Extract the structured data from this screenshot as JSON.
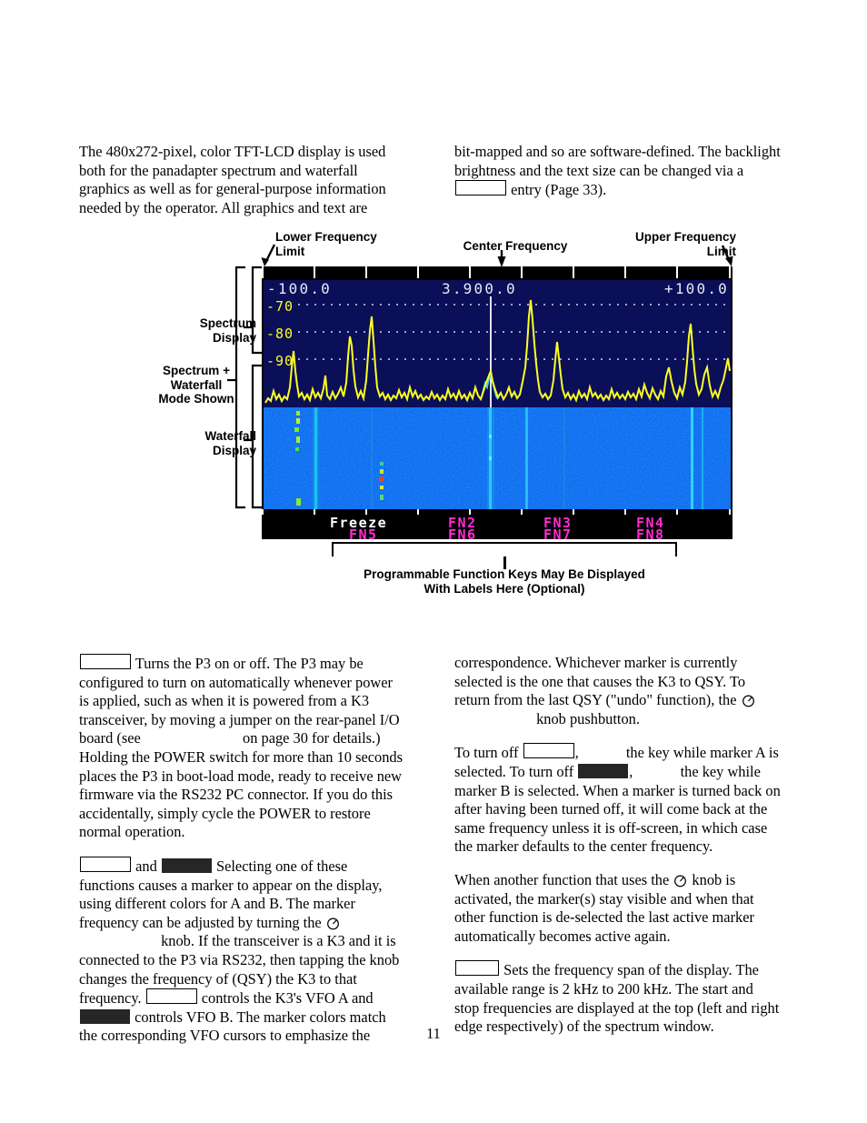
{
  "page": {
    "number": "11"
  },
  "intro": {
    "left": [
      "The 480x272-pixel, color TFT-LCD display is used both for the panadapter spectrum and waterfall graphics as well as for general-purpose information needed by the operator. All graphics and text are"
    ],
    "right_before_box": "bit-mapped and so are software-defined. The backlight brightness and the text size can be changed via a ",
    "right_after_box": " entry (Page 33)."
  },
  "figure": {
    "callouts": {
      "lower_limit": "Lower Frequency\nLimit",
      "center_frequency": "Center Frequency",
      "upper_limit": "Upper Frequency\nLimit",
      "spectrum_display": "Spectrum\nDisplay",
      "spectrum_waterfall_mode": "Spectrum +\nWaterfall\nMode Shown",
      "waterfall_display": "Waterfall\nDisplay"
    },
    "caption": "Programmable Function Keys May Be Displayed\nWith Labels Here (Optional)",
    "lcd": {
      "freq_left": "-100.0",
      "freq_center": "3.900.0",
      "freq_right": "+100.0",
      "db_labels": [
        "-70",
        "-80",
        "-90"
      ],
      "fn_keys_row1": [
        "Freeze",
        "FN2",
        "FN3",
        "FN4"
      ],
      "fn_keys_row2": [
        "FN5",
        "FN6",
        "FN7",
        "FN8"
      ],
      "colors": {
        "spectrum_background": "#0a0f57",
        "trace": "#ffff20",
        "fn_magenta": "#ff2ad4",
        "fn_white": "#ffffff",
        "waterfall_background": "#000013"
      }
    }
  },
  "power_paragraph": {
    "seg1": " Turns the P3 on or off. The P3 may be configured to turn on automatically whenever power is applied, such as when it is powered from a K3 transceiver, by moving a jumper on the rear-panel I/O board (see ",
    "seg2": " on page 30 for details.) Holding the POWER switch for more than 10 seconds places the P3 in boot-load mode, ready to receive new firmware via the RS232 PC connector. If you do this accidentally, simply cycle the POWER to restore normal operation."
  },
  "marker_paragraph": {
    "seg1": " and ",
    "seg2": " Selecting one of these functions causes a marker to appear on the display, using different colors for A and B. The marker frequency can be adjusted by turning the ",
    "seg3": " knob. If the transceiver is a K3 and it is connected to the P3 via RS232, then tapping the knob changes the frequency of (QSY) the K3 to that frequency. ",
    "seg4": " controls the K3's VFO A and ",
    "seg5": " controls VFO B. The marker colors match the corresponding VFO cursors to emphasize the"
  },
  "correspondence_paragraph": {
    "seg1": "correspondence. Whichever marker is currently selected is the one that causes the K3 to QSY. To return from the last QSY (\"undo\" function), the ",
    "seg2": " knob pushbutton."
  },
  "turnoff_paragraph": {
    "seg1": "To turn off ",
    "seg2": ", ",
    "seg3": " the key while marker A is selected. To turn off ",
    "seg4": ", ",
    "seg5": " the key while marker B is selected. When a marker is turned back on after having been turned off, it will come back at the same frequency unless it is off-screen, in which case the marker defaults to the center frequency."
  },
  "another_function_paragraph": {
    "seg1": "When another function that uses the ",
    "seg2": " knob is activated, the marker(s) stay visible and when that other function is de-selected the last active marker automatically becomes active again."
  },
  "span_paragraph": {
    "seg1": " Sets the frequency span of the display. The available range is 2 kHz to 200 kHz. The start and stop frequencies are displayed at the top (left and right edge respectively) of the spectrum window."
  },
  "icons": {
    "knob": "rotary-knob-icon"
  }
}
